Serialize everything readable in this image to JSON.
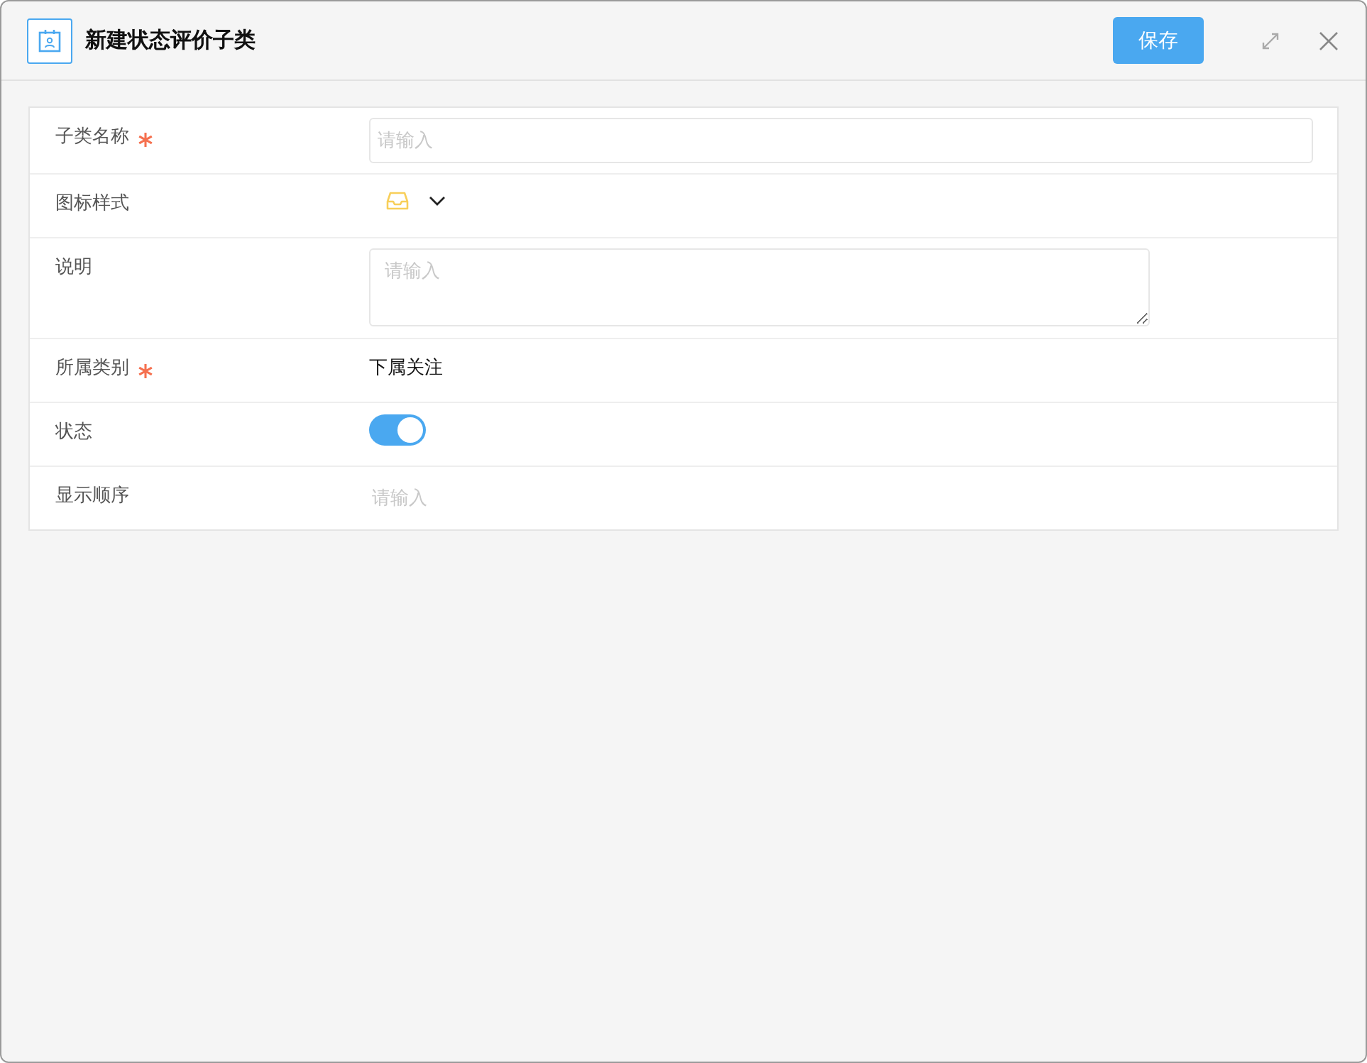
{
  "window": {
    "title": "新建状态评价子类",
    "save_button": "保存"
  },
  "form": {
    "rows": [
      {
        "kind": "input",
        "label": "子类名称",
        "required": true,
        "placeholder": "请输入"
      },
      {
        "kind": "icon-select",
        "label": "图标样式",
        "required": false
      },
      {
        "kind": "textarea",
        "label": "说明",
        "required": false,
        "placeholder": "请输入"
      },
      {
        "kind": "value",
        "label": "所属类别",
        "required": true,
        "value": "下属关注"
      },
      {
        "kind": "switch",
        "label": "状态",
        "required": false,
        "on": true
      },
      {
        "kind": "plain-input",
        "label": "显示顺序",
        "required": false,
        "placeholder": "请输入"
      }
    ]
  }
}
